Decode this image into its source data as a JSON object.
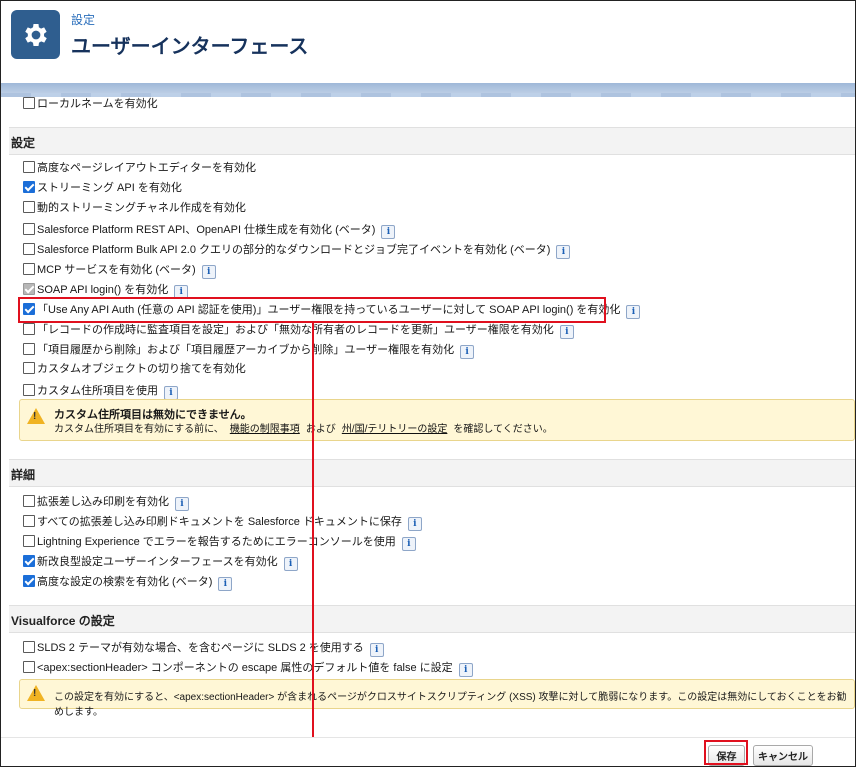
{
  "header": {
    "breadcrumb": "設定",
    "title": "ユーザーインターフェース"
  },
  "top_row": {
    "label": "ローカルネームを有効化",
    "checked": false
  },
  "sections": {
    "settings": {
      "title": "設定"
    },
    "details": {
      "title": "詳細"
    },
    "visualforce": {
      "title": "Visualforce の設定"
    }
  },
  "settings_items": [
    {
      "label": "高度なページレイアウトエディターを有効化",
      "checked": false,
      "info": false
    },
    {
      "label": "ストリーミング API を有効化",
      "checked": true,
      "info": false
    },
    {
      "label": "動的ストリーミングチャネル作成を有効化",
      "checked": false,
      "info": false
    },
    {
      "label": "Salesforce Platform REST API、OpenAPI 仕様生成を有効化 (ベータ)",
      "checked": false,
      "info": true
    },
    {
      "label": "Salesforce Platform Bulk API 2.0 クエリの部分的なダウンロードとジョブ完了イベントを有効化 (ベータ)",
      "checked": false,
      "info": true
    },
    {
      "label": "MCP サービスを有効化 (ベータ)",
      "checked": false,
      "info": true
    },
    {
      "label": "SOAP API login() を有効化",
      "checked": true,
      "disabled": true,
      "info": true
    },
    {
      "label": "「Use Any API Auth (任意の API 認証を使用)」ユーザー権限を持っているユーザーに対して SOAP API login() を有効化",
      "checked": true,
      "info": true
    },
    {
      "label": "「レコードの作成時に監査項目を設定」および「無効な所有者のレコードを更新」ユーザー権限を有効化",
      "checked": false,
      "info": true
    },
    {
      "label": "「項目履歴から削除」および「項目履歴アーカイブから削除」ユーザー権限を有効化",
      "checked": false,
      "info": true
    },
    {
      "label": "カスタムオブジェクトの切り捨てを有効化",
      "checked": false,
      "info": false
    },
    {
      "label": "カスタム住所項目を使用",
      "checked": false,
      "info": true
    }
  ],
  "warning1": {
    "title": "カスタム住所項目は無効にできません。",
    "text_before": "カスタム住所項目を有効にする前に、",
    "link1": "機能の制限事項",
    "middle": "および",
    "link2": "州/国/テリトリーの設定",
    "text_after": "を確認してください。"
  },
  "detail_items": [
    {
      "label": "拡張差し込み印刷を有効化",
      "checked": false,
      "info": true
    },
    {
      "label": "すべての拡張差し込み印刷ドキュメントを Salesforce ドキュメントに保存",
      "checked": false,
      "info": true
    },
    {
      "label": "Lightning Experience でエラーを報告するためにエラーコンソールを使用",
      "checked": false,
      "info": true
    },
    {
      "label": "新改良型設定ユーザーインターフェースを有効化",
      "checked": true,
      "info": true
    },
    {
      "label": "高度な設定の検索を有効化 (ベータ)",
      "checked": true,
      "info": true
    }
  ],
  "vf_items": [
    {
      "label": "SLDS 2 テーマが有効な場合、を含むページに SLDS 2 を使用する",
      "checked": false,
      "info": true
    },
    {
      "label": "<apex:sectionHeader> コンポーネントの escape 属性のデフォルト値を false に設定",
      "checked": false,
      "info": true
    }
  ],
  "warning2": {
    "text": "この設定を有効にすると、<apex:sectionHeader> が含まれるページがクロスサイトスクリプティング (XSS) 攻撃に対して脆弱になります。この設定は無効にしておくことをお勧めします。"
  },
  "footer": {
    "save": "保存",
    "cancel": "キャンセル"
  },
  "colors": {
    "accent": "#1b6ed8",
    "highlight": "#e0101e",
    "header_icon": "#2f5e8f"
  }
}
